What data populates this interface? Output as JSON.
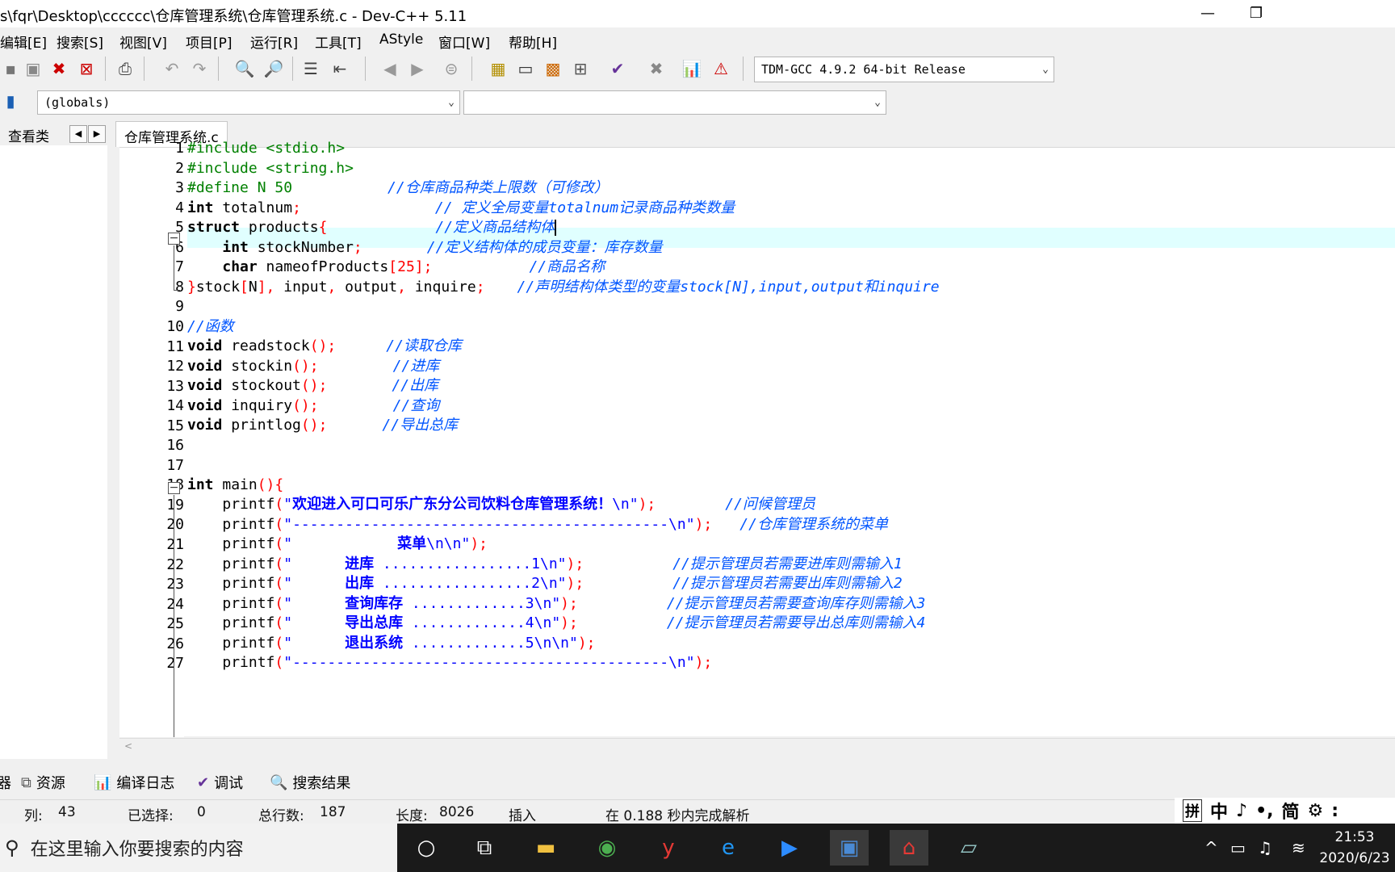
{
  "window": {
    "title": "s\\fqr\\Desktop\\cccccc\\仓库管理系统\\仓库管理系统.c - Dev-C++ 5.11",
    "minimize": "—",
    "restore": "❐"
  },
  "menu": [
    "编辑[E]",
    "搜索[S]",
    "视图[V]",
    "项目[P]",
    "运行[R]",
    "工具[T]",
    "AStyle",
    "窗口[W]",
    "帮助[H]"
  ],
  "compiler_select": "TDM-GCC 4.9.2 64-bit Release",
  "scope_select": "(globals)",
  "symbol_select": "",
  "left_panel": {
    "tab_label": "查看类"
  },
  "editor": {
    "file_tab": "仓库管理系统.c",
    "line_numbers": [
      "1",
      "2",
      "3",
      "4",
      "5",
      "6",
      "7",
      "8",
      "9",
      "10",
      "11",
      "12",
      "13",
      "14",
      "15",
      "16",
      "17",
      "18",
      "19",
      "20",
      "21",
      "22",
      "23",
      "24",
      "25",
      "26",
      "27"
    ],
    "lines": {
      "l1": "#include <stdio.h>",
      "l2": "#include <string.h>",
      "l3a": "#define N 50",
      "l3c": "//仓库商品种类上限数（可修改）",
      "l4a": "int",
      "l4b": " totalnum",
      "l4s": ";",
      "l4c": "// 定义全局变量totalnum记录商品种类数量",
      "l5a": "struct",
      "l5b": " products",
      "l5s": "{",
      "l5c": "//定义商品结构体",
      "l6a": "int",
      "l6b": " stockNumber",
      "l6s": ";",
      "l6c": "//定义结构体的成员变量：库存数量",
      "l7a": "char",
      "l7b": " nameofProducts",
      "l7s": "[25];",
      "l7c": "//商品名称",
      "l8s1": "}",
      "l8b": "stock",
      "l8s2": "[",
      "l8n": "N",
      "l8s3": "],",
      "l8d": " input",
      "l8s4": ",",
      "l8e": " output",
      "l8s5": ",",
      "l8f": " inquire",
      "l8s6": ";",
      "l8c": "//声明结构体类型的变量stock[N],input,output和inquire",
      "l10c": "//函数",
      "l11a": "void",
      "l11b": " readstock",
      "l11s": "();",
      "l11c": "//读取仓库",
      "l12a": "void",
      "l12b": " stockin",
      "l12s": "();",
      "l12c": "//进库",
      "l13a": "void",
      "l13b": " stockout",
      "l13s": "();",
      "l13c": "//出库",
      "l14a": "void",
      "l14b": " inquiry",
      "l14s": "();",
      "l14c": "//查询",
      "l15a": "void",
      "l15b": " printlog",
      "l15s": "();",
      "l15c": "//导出总库",
      "l18a": "int",
      "l18b": " main",
      "l18s": "(){",
      "l19f": "printf",
      "l19s": "(",
      "l19str1": "\"",
      "l19cn": "欢迎进入可口可乐广东分公司饮料仓库管理系统！",
      "l19str2": "\\n\"",
      "l19e": ");",
      "l19c": "//问候管理员",
      "l20f": "printf",
      "l20s": "(",
      "l20str": "\"-------------------------------------------\\n\"",
      "l20e": ");",
      "l20c": "//仓库管理系统的菜单",
      "l21f": "printf",
      "l21s": "(",
      "l21str1": "\"            ",
      "l21cn": "菜单",
      "l21str2": "\\n\\n\"",
      "l21e": ");",
      "l22f": "printf",
      "l22s": "(",
      "l22str1": "\"      ",
      "l22cn": "进库",
      "l22str2": " .................1\\n\"",
      "l22e": ");",
      "l22c": "//提示管理员若需要进库则需输入1",
      "l23f": "printf",
      "l23s": "(",
      "l23str1": "\"      ",
      "l23cn": "出库",
      "l23str2": " .................2\\n\"",
      "l23e": ");",
      "l23c": "//提示管理员若需要出库则需输入2",
      "l24f": "printf",
      "l24s": "(",
      "l24str1": "\"      ",
      "l24cn": "查询库存",
      "l24str2": " .............3\\n\"",
      "l24e": ");",
      "l24c": "//提示管理员若需要查询库存则需输入3",
      "l25f": "printf",
      "l25s": "(",
      "l25str1": "\"      ",
      "l25cn": "导出总库",
      "l25str2": " .............4\\n\"",
      "l25e": ");",
      "l25c": "//提示管理员若需要导出总库则需输入4",
      "l26f": "printf",
      "l26s": "(",
      "l26str1": "\"      ",
      "l26cn": "退出系统",
      "l26str2": " .............5\\n\\n\"",
      "l26e": ");",
      "l27f": "printf",
      "l27s": "(",
      "l27str": "\"-------------------------------------------\\n\"",
      "l27e": ");"
    }
  },
  "bottom_tabs": [
    "器",
    "资源",
    "编译日志",
    "调试",
    "搜索结果"
  ],
  "status": {
    "col_label": "列:",
    "col_value": "43",
    "sel_label": "已选择:",
    "sel_value": "0",
    "lines_label": "总行数:",
    "lines_value": "187",
    "len_label": "长度:",
    "len_value": "8026",
    "mode": "插入",
    "parse": "在 0.188 秒内完成解析"
  },
  "ime": [
    "拼",
    "中",
    "♪",
    "•,",
    "简",
    "⚙",
    ":"
  ],
  "taskbar": {
    "search_placeholder": "在这里输入你要搜索的内容",
    "time": "21:53",
    "date": "2020/6/23"
  },
  "colors": {
    "keyword": "#000000",
    "preprocessor": "#008000",
    "comment": "#0055ff",
    "string": "#0000ff",
    "symbol": "#ff0000",
    "current_line": "#e0ffff"
  }
}
